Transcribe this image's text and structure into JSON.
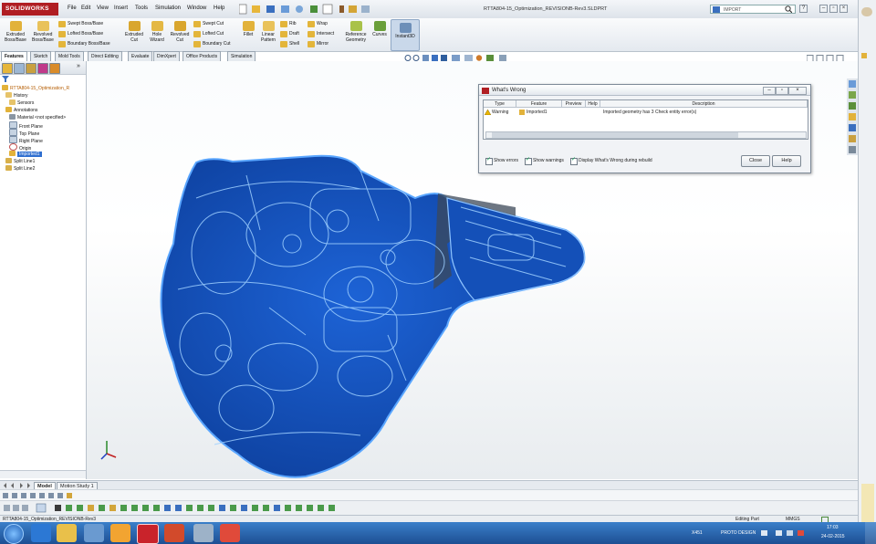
{
  "app": {
    "logo_text": "SOLIDWORKS",
    "document_title": "RTTA804-15_Optimization_REVISIONB-Rev3.SLDPRT",
    "search_text": "IMPORT"
  },
  "menu": [
    "File",
    "Edit",
    "View",
    "Insert",
    "Tools",
    "Simulation",
    "Window",
    "Help"
  ],
  "ribbon": {
    "large_buttons": [
      {
        "label": "Extruded\nBoss/Base",
        "icon": "extrude-boss-icon"
      },
      {
        "label": "Revolved\nBoss/Base",
        "icon": "revolve-boss-icon"
      },
      {
        "label": "Extruded\nCut",
        "icon": "extrude-cut-icon"
      },
      {
        "label": "Hole\nWizard",
        "icon": "hole-wizard-icon"
      },
      {
        "label": "Revolved\nCut",
        "icon": "revolve-cut-icon"
      },
      {
        "label": "Fillet",
        "icon": "fillet-icon"
      },
      {
        "label": "Linear\nPattern",
        "icon": "linear-pattern-icon"
      },
      {
        "label": "Reference\nGeometry",
        "icon": "reference-geometry-icon"
      },
      {
        "label": "Curves",
        "icon": "curves-icon"
      },
      {
        "label": "Instant3D",
        "icon": "instant3d-icon"
      }
    ],
    "small_buttons": [
      "Swept Boss/Base",
      "Lofted Boss/Base",
      "Boundary Boss/Base",
      "Swept Cut",
      "Lofted Cut",
      "Boundary Cut",
      "Rib",
      "Draft",
      "Shell",
      "Wrap",
      "Intersect",
      "Mirror"
    ]
  },
  "tabs": [
    "Features",
    "Sketch",
    "Mold Tools",
    "Direct Editing",
    "Evaluate",
    "DimXpert",
    "Office Products",
    "Simulation"
  ],
  "active_tab": "Features",
  "tree": [
    {
      "label": "RTTA804-15_Optimization_R",
      "indent": 0,
      "icon": "part-icon"
    },
    {
      "label": "History",
      "indent": 1,
      "icon": "folder-icon"
    },
    {
      "label": "Sensors",
      "indent": 1,
      "icon": "folder-icon"
    },
    {
      "label": "Annotations",
      "indent": 1,
      "icon": "annotation-icon"
    },
    {
      "label": "Material <not specified>",
      "indent": 1,
      "icon": "material-icon"
    },
    {
      "label": "Front Plane",
      "indent": 1,
      "icon": "plane-icon"
    },
    {
      "label": "Top Plane",
      "indent": 1,
      "icon": "plane-icon"
    },
    {
      "label": "Right Plane",
      "indent": 1,
      "icon": "plane-icon"
    },
    {
      "label": "Origin",
      "indent": 1,
      "icon": "origin-icon"
    },
    {
      "label": "Imported1",
      "indent": 1,
      "icon": "imported-icon",
      "selected": true
    },
    {
      "label": "Split Line1",
      "indent": 1,
      "icon": "split-line-icon"
    },
    {
      "label": "Split Line2",
      "indent": 1,
      "icon": "split-line-icon"
    }
  ],
  "dialog": {
    "title": "What's Wrong",
    "columns": [
      "Type",
      "Feature",
      "Preview",
      "Help",
      "Description"
    ],
    "rows": [
      {
        "type": "Warning",
        "feature": "Imported1",
        "preview": "",
        "help": "",
        "description": "Imported geometry has 3 Check entity error(s)"
      }
    ],
    "checkboxes": [
      {
        "label": "Show errors",
        "checked": true
      },
      {
        "label": "Show warnings",
        "checked": true
      },
      {
        "label": "Display What's Wrong during rebuild",
        "checked": true
      }
    ],
    "close_label": "Close",
    "help_label": "Help"
  },
  "bottom_tabs": [
    "Model",
    "Motion Study 1"
  ],
  "active_bottom_tab": "Model",
  "status": {
    "left": "RTTA804-15_Optimization_REVISIONB-Rev3",
    "mode": "Editing Part",
    "units": "MMGS"
  },
  "taskbar": {
    "tray_left": "X451",
    "tray_label": "PROTO DESIGN",
    "time": "17:03",
    "date": "24-02-2015"
  },
  "colors": {
    "model_blue": "#1556c9",
    "model_edge": "#8fc4ff",
    "brand_red": "#b01e23",
    "taskbar_blue": "#2a66b0"
  }
}
